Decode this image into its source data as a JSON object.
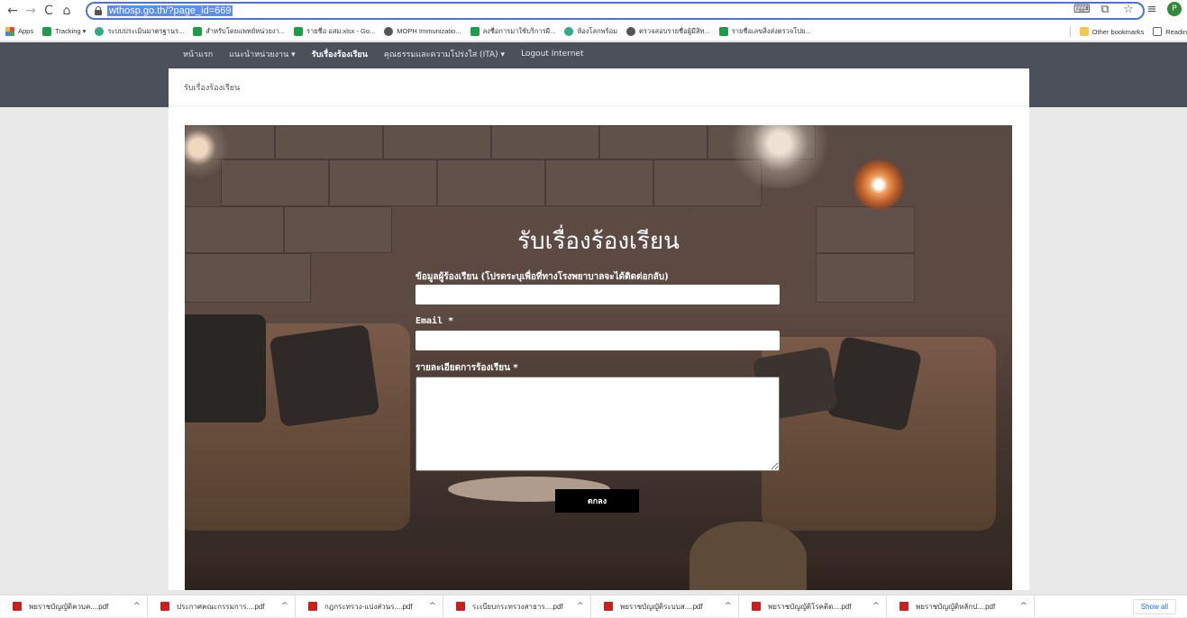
{
  "browser": {
    "url": "wthosp.go.th/?page_id=669",
    "nav": {
      "back": "←",
      "forward": "→",
      "reload": "C",
      "home": "⌂"
    },
    "profile_initial": "P",
    "bookmarks": [
      {
        "label": "Apps",
        "icon": "apps-grid-icon"
      },
      {
        "label": "Tracking ▾",
        "icon": "green-sheet-icon"
      },
      {
        "label": "ระบบประเมินมาตรฐานร...",
        "icon": "globe-icon"
      },
      {
        "label": "สำหรับโดยแพทย์หน่วยงา...",
        "icon": "green-sheet-icon"
      },
      {
        "label": "รายชื่อ อสม.xlsx - Go...",
        "icon": "green-sheet-icon"
      },
      {
        "label": "MOPH Immunizatio...",
        "icon": "globe-icon"
      },
      {
        "label": "ลงชื่อการมาใช้บริการผี...",
        "icon": "green-sheet-icon"
      },
      {
        "label": "ห้องโลกพร้อม",
        "icon": "globe-icon"
      },
      {
        "label": "ตรวจสอบรายชื่อผู้มีสิท...",
        "icon": "globe-icon"
      },
      {
        "label": "รายชื่อเลขสิ่งส่งตรวจโปย...",
        "icon": "green-sheet-icon"
      }
    ],
    "other_bookmarks": "Other bookmarks",
    "reading_list": "Readin"
  },
  "site": {
    "menu": [
      {
        "label": "หน้าแรก",
        "active": false
      },
      {
        "label": "แนะนำหน่วยงาน ▾",
        "active": false
      },
      {
        "label": "รับเรื่องร้องเรียน",
        "active": true
      },
      {
        "label": "คุณธรรมและความโปร่งใส (ITA) ▾",
        "active": false
      },
      {
        "label": "Logout Internet",
        "active": false
      }
    ],
    "breadcrumb": "รับเรื่องร้องเรียน",
    "form": {
      "title": "รับเรื่องร้องเรียน",
      "contact_label": "ข้อมูลผู้ร้องเรียน (โปรดระบุเพื่อที่ทางโรงพยาบาลจะได้ติดต่อกลับ)",
      "contact_value": "",
      "email_label": "Email *",
      "email_value": "",
      "detail_label": "รายละเอียดการร้องเรียน *",
      "detail_value": "",
      "submit_label": "ตกลง"
    }
  },
  "downloads": {
    "items": [
      "พยราชบัญญัติควบค....pdf",
      "ประกาศคณะกรรมการ....pdf",
      "กฎกระทรวง-แบ่งส่วนร....pdf",
      "ระเบียบกระทรวงสาธาร....pdf",
      "พยราชบัญญัติระบบส....pdf",
      "พยราชบัญญัติโรคติด....pdf",
      "พยราชบัญญัติหลักป....pdf"
    ],
    "show_all": "Show all"
  }
}
